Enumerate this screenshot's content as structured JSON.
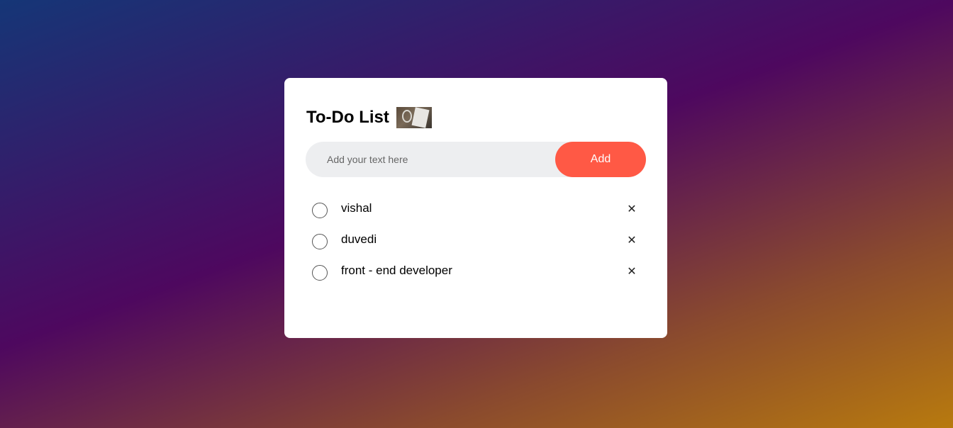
{
  "header": {
    "title": "To-Do List",
    "image_icon": "clipboard-image"
  },
  "input": {
    "placeholder": "Add your text here",
    "value": "",
    "add_label": "Add"
  },
  "tasks": [
    {
      "text": "vishal",
      "checked": false,
      "remove_icon": "close-icon"
    },
    {
      "text": "duvedi",
      "checked": false,
      "remove_icon": "close-icon"
    },
    {
      "text": "front - end developer",
      "checked": false,
      "remove_icon": "close-icon"
    }
  ],
  "colors": {
    "accent": "#ff5945",
    "input_bg": "#edeef0",
    "card_bg": "#ffffff",
    "gradient_start": "#153677",
    "gradient_end": "#b87a0e"
  },
  "glyphs": {
    "remove": "✕"
  }
}
